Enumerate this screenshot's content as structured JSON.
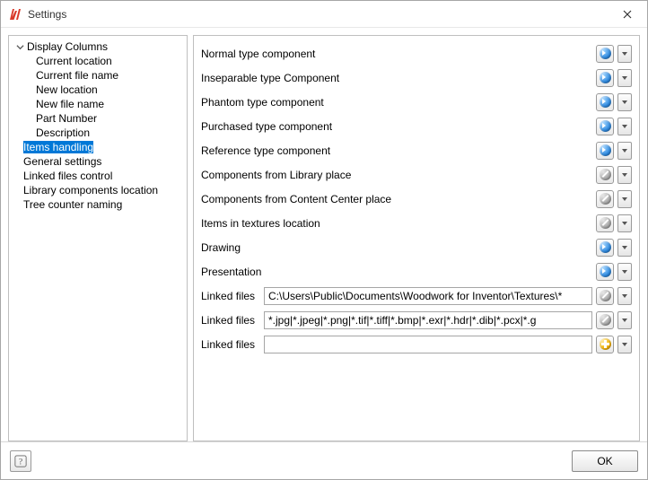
{
  "window": {
    "title": "Settings",
    "close_tooltip": "Close"
  },
  "tree": {
    "root": "Display Columns",
    "children": [
      "Current location",
      "Current file name",
      "New location",
      "New file name",
      "Part Number",
      "Description"
    ],
    "nodes": [
      {
        "label": "Items handling",
        "selected": true
      },
      {
        "label": "General settings",
        "selected": false
      },
      {
        "label": "Linked files control",
        "selected": false
      },
      {
        "label": "Library components location",
        "selected": false
      },
      {
        "label": "Tree counter naming",
        "selected": false
      }
    ]
  },
  "rows": [
    {
      "label": "Normal type component",
      "status": "blue"
    },
    {
      "label": "Inseparable type Component",
      "status": "blue"
    },
    {
      "label": "Phantom type component",
      "status": "blue"
    },
    {
      "label": "Purchased type component",
      "status": "blue"
    },
    {
      "label": "Reference type component",
      "status": "blue"
    },
    {
      "label": "Components from Library place",
      "status": "gray"
    },
    {
      "label": "Components from Content Center place",
      "status": "gray"
    },
    {
      "label": "Items in textures location",
      "status": "gray"
    },
    {
      "label": "Drawing",
      "status": "blue"
    },
    {
      "label": "Presentation",
      "status": "blue"
    }
  ],
  "linked_files": {
    "label": "Linked files",
    "rows": [
      {
        "value": "C:\\Users\\Public\\Documents\\Woodwork for Inventor\\Textures\\*",
        "status": "gray"
      },
      {
        "value": "*.jpg|*.jpeg|*.png|*.tif|*.tiff|*.bmp|*.exr|*.hdr|*.dib|*.pcx|*.g",
        "status": "gray"
      },
      {
        "value": "",
        "status": "gold"
      }
    ]
  },
  "footer": {
    "help_tooltip": "Help",
    "ok": "OK"
  },
  "icons": {
    "app": "app-icon",
    "expander": "expander-down"
  }
}
